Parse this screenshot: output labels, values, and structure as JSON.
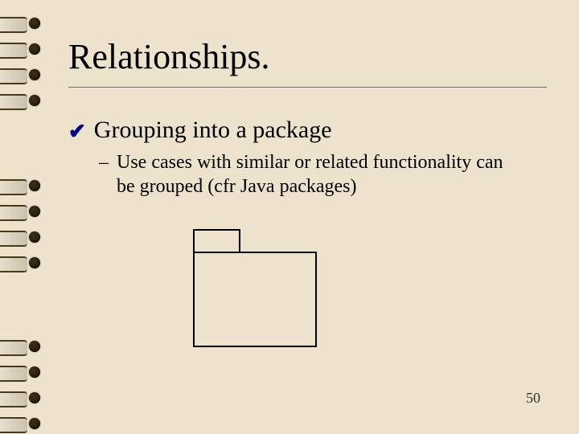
{
  "title": "Relationships.",
  "main_point": "Grouping into a package",
  "sub_point": "Use cases with similar or related functionality can be grouped (cfr Java packages)",
  "page_number": "50"
}
